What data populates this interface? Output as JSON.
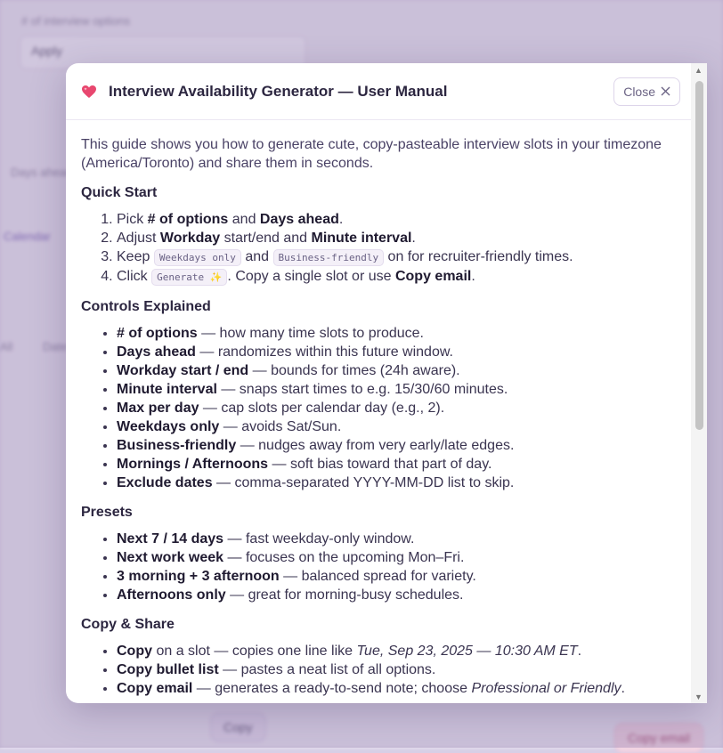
{
  "background": {
    "field_label": "# of interview options",
    "field_value": "Apply",
    "side_label": "Days ahead",
    "link_text": "Calendar",
    "tab_a": "All",
    "tab_b": "Dates",
    "footer_btn": "Copy",
    "primary_btn": "Copy email"
  },
  "modal": {
    "title": "Interview Availability Generator — User Manual",
    "close_label": "Close",
    "intro": "This guide shows you how to generate cute, copy-pasteable interview slots in your timezone (America/Toronto) and share them in seconds.",
    "quick_start": {
      "heading": "Quick Start",
      "items": [
        {
          "pre": "Pick ",
          "b1": "# of options",
          "mid": " and ",
          "b2": "Days ahead",
          "post": "."
        },
        {
          "pre": "Adjust ",
          "b1": "Workday",
          "mid": " start/end and ",
          "b2": "Minute interval",
          "post": "."
        },
        {
          "pre": "Keep ",
          "c1": "Weekdays only",
          "mid": " and ",
          "c2": "Business-friendly",
          "post": " on for recruiter-friendly times."
        },
        {
          "pre": "Click ",
          "c1": "Generate ✨",
          "mid": ". Copy a single slot or use ",
          "b2": "Copy email",
          "post": "."
        }
      ]
    },
    "controls": {
      "heading": "Controls Explained",
      "items": [
        {
          "b": "# of options",
          "t": " — how many time slots to produce."
        },
        {
          "b": "Days ahead",
          "t": " — randomizes within this future window."
        },
        {
          "b": "Workday start / end",
          "t": " — bounds for times (24h aware)."
        },
        {
          "b": "Minute interval",
          "t": " — snaps start times to e.g. 15/30/60 minutes."
        },
        {
          "b": "Max per day",
          "t": " — cap slots per calendar day (e.g., 2)."
        },
        {
          "b": "Weekdays only",
          "t": " — avoids Sat/Sun."
        },
        {
          "b": "Business-friendly",
          "t": " — nudges away from very early/late edges."
        },
        {
          "b": "Mornings / Afternoons",
          "t": " — soft bias toward that part of day."
        },
        {
          "b": "Exclude dates",
          "t": " — comma-separated YYYY-MM-DD list to skip."
        }
      ]
    },
    "presets": {
      "heading": "Presets",
      "items": [
        {
          "b": "Next 7 / 14 days",
          "t": " — fast weekday-only window."
        },
        {
          "b": "Next work week",
          "t": " — focuses on the upcoming Mon–Fri."
        },
        {
          "b": "3 morning + 3 afternoon",
          "t": " — balanced spread for variety."
        },
        {
          "b": "Afternoons only",
          "t": " — great for morning-busy schedules."
        }
      ]
    },
    "copy_share": {
      "heading": "Copy & Share",
      "items": [
        {
          "b": "Copy",
          "t": " on a slot — copies one line like ",
          "i": "Tue, Sep 23, 2025 — 10:30 AM ET",
          "post": "."
        },
        {
          "b": "Copy bullet list",
          "t": " — pastes a neat list of all options."
        },
        {
          "b": "Copy email",
          "t": " — generates a ready-to-send note; choose ",
          "i": "Professional or Friendly",
          "post": "."
        }
      ]
    }
  }
}
